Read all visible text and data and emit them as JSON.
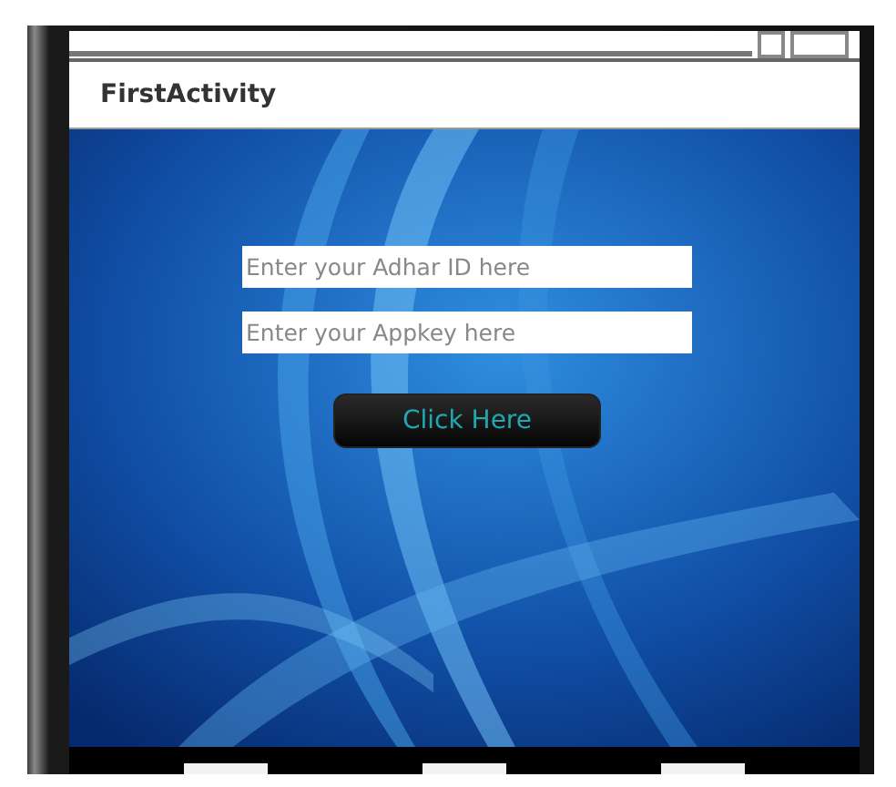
{
  "action_bar": {
    "title": "FirstActivity"
  },
  "form": {
    "fields": [
      {
        "placeholder": "Enter your Adhar ID here"
      },
      {
        "placeholder": "Enter your Appkey here"
      }
    ],
    "button": "Click Here"
  }
}
